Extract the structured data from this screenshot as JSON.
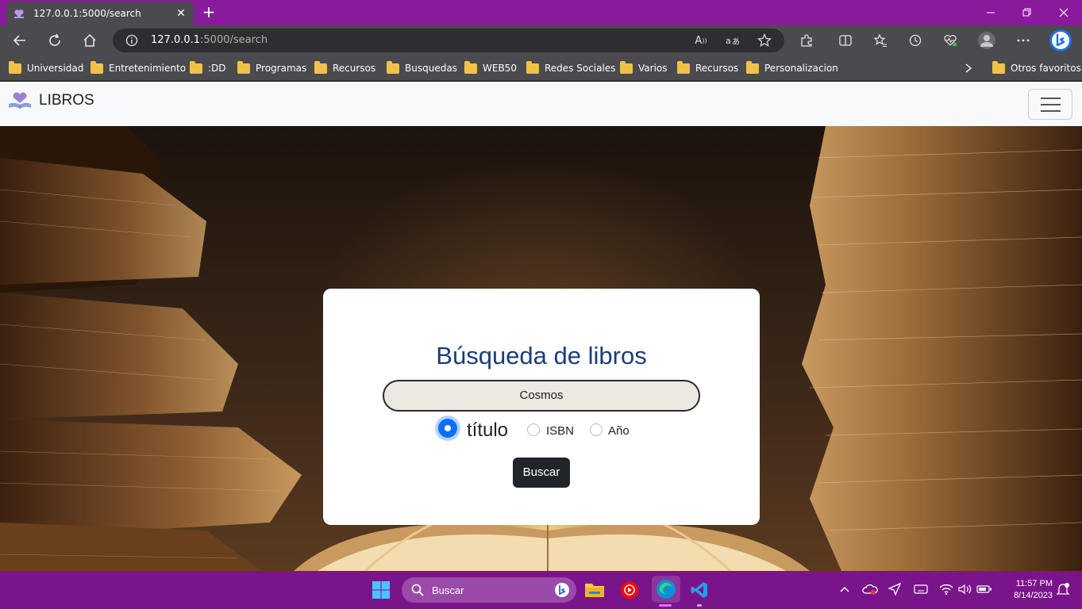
{
  "browser": {
    "tab_title": "127.0.0.1:5000/search",
    "url_host": "127.0.0.1",
    "url_rest": ":5000/search",
    "accent_color": "#8a1a9c"
  },
  "bookmarks": {
    "items": [
      "Universidad",
      "Entretenimiento",
      ":DD",
      "Programas",
      "Recursos",
      "Busquedas",
      "WEB50",
      "Redes Sociales",
      "Varios",
      "Recursos",
      "Personalizacion"
    ],
    "overflow": "Otros favoritos"
  },
  "navbar": {
    "brand": "LIBROS"
  },
  "search_card": {
    "title": "Búsqueda de libros",
    "query": "Cosmos",
    "options": [
      {
        "label": "título",
        "checked": true
      },
      {
        "label": "ISBN",
        "checked": false
      },
      {
        "label": "Año",
        "checked": false
      }
    ],
    "submit_label": "Buscar"
  },
  "taskbar": {
    "search_label": "Buscar",
    "time": "11:57 PM",
    "date": "8/14/2023"
  }
}
